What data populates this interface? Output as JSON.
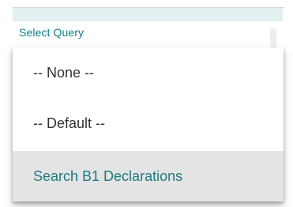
{
  "field": {
    "label": "Select Query"
  },
  "dropdown": {
    "items": [
      {
        "label": "-- None --",
        "highlighted": false
      },
      {
        "label": "-- Default --",
        "highlighted": false
      },
      {
        "label": "Search B1 Declarations",
        "highlighted": true
      }
    ]
  },
  "colors": {
    "accent": "#0b7f8a",
    "highlight_bg": "#e4e4e4",
    "highlight_text": "#1d7b80",
    "text": "#333333"
  }
}
